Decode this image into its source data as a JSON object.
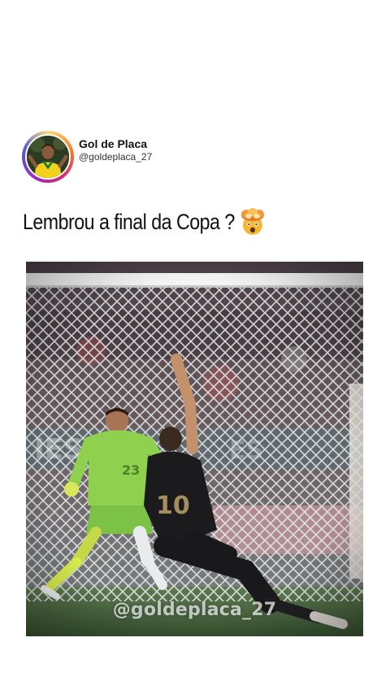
{
  "post": {
    "author": {
      "display_name": "Gol de Placa",
      "handle": "@goldeplaca_27",
      "avatar_icon": "profile-photo-soccer-player"
    },
    "caption": {
      "text": "Lembrou a final da Copa ?",
      "emoji": "exploding-head-emoji"
    },
    "media": {
      "description_icon": "soccer-goal-video-frame",
      "watermark": "@goldeplaca_27"
    }
  },
  "colors": {
    "background": "#ffffff",
    "text": "#111111",
    "keeper_kit": "#8fd14f",
    "pitch": "#3f6b3a"
  }
}
